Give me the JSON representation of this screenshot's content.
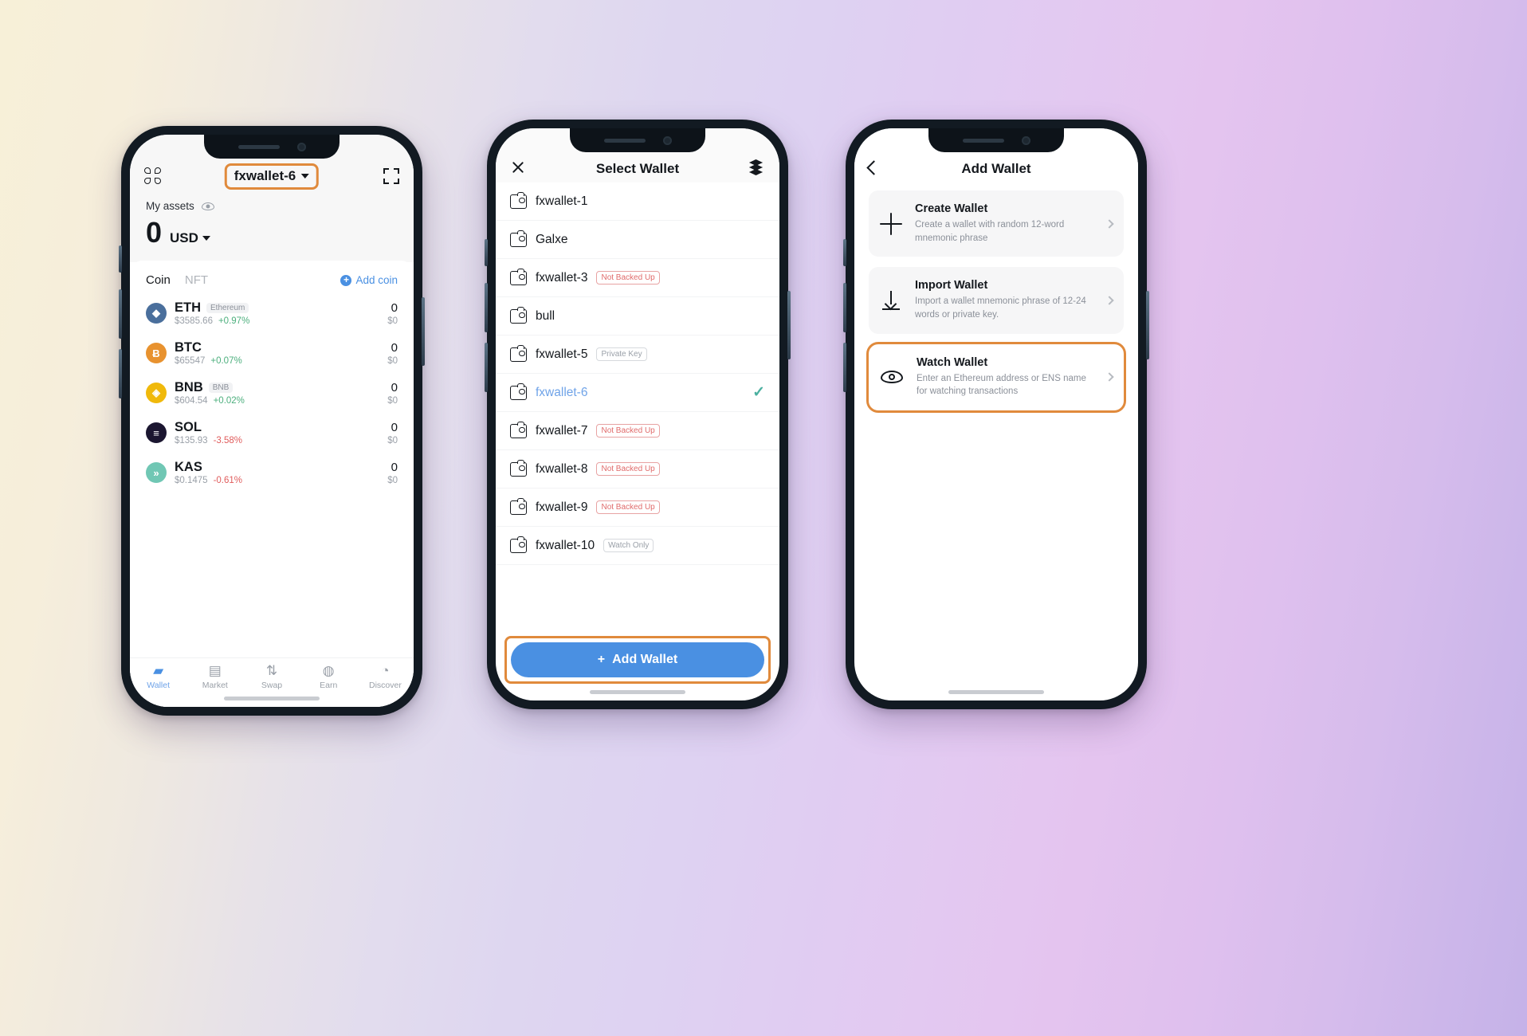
{
  "phone1": {
    "header": {
      "grid_icon": "grid-icon",
      "wallet_name": "fxwallet-6",
      "expand_icon": "expand-icon"
    },
    "assets": {
      "label": "My assets",
      "eye_icon": "eye-icon",
      "balance": "0",
      "currency": "USD"
    },
    "tabs": [
      {
        "label": "Coin",
        "active": true
      },
      {
        "label": "NFT",
        "active": false
      }
    ],
    "add_coin": "Add coin",
    "coins": [
      {
        "symbol": "ETH",
        "network": "Ethereum",
        "price": "$3585.66",
        "change": "+0.97%",
        "dir": "up",
        "amount": "0",
        "value": "$0",
        "color": "#4a6f9c",
        "glyph": "◆"
      },
      {
        "symbol": "BTC",
        "network": "",
        "price": "$65547",
        "change": "+0.07%",
        "dir": "up",
        "amount": "0",
        "value": "$0",
        "color": "#e8922f",
        "glyph": "Ƀ"
      },
      {
        "symbol": "BNB",
        "network": "BNB",
        "price": "$604.54",
        "change": "+0.02%",
        "dir": "up",
        "amount": "0",
        "value": "$0",
        "color": "#f0b90b",
        "glyph": "◈"
      },
      {
        "symbol": "SOL",
        "network": "",
        "price": "$135.93",
        "change": "-3.58%",
        "dir": "down",
        "amount": "0",
        "value": "$0",
        "color": "#1b1630",
        "glyph": "≡"
      },
      {
        "symbol": "KAS",
        "network": "",
        "price": "$0.1475",
        "change": "-0.61%",
        "dir": "down",
        "amount": "0",
        "value": "$0",
        "color": "#70c7b4",
        "glyph": "»"
      }
    ],
    "nav": [
      {
        "label": "Wallet",
        "icon": "wallet-icon",
        "glyph": "▰",
        "active": true
      },
      {
        "label": "Market",
        "icon": "chart-icon",
        "glyph": "▤",
        "active": false
      },
      {
        "label": "Swap",
        "icon": "swap-icon",
        "glyph": "⇅",
        "active": false
      },
      {
        "label": "Earn",
        "icon": "piggy-icon",
        "glyph": "◍",
        "active": false
      },
      {
        "label": "Discover",
        "icon": "compass-icon",
        "glyph": "◔",
        "active": false
      }
    ]
  },
  "phone2": {
    "header": {
      "close_icon": "close-icon",
      "title": "Select Wallet",
      "layers_icon": "layers-icon"
    },
    "wallets": [
      {
        "name": "fxwallet-1",
        "tag": "",
        "tag_style": "",
        "selected": false
      },
      {
        "name": "Galxe",
        "tag": "",
        "tag_style": "",
        "selected": false
      },
      {
        "name": "fxwallet-3",
        "tag": "Not Backed Up",
        "tag_style": "red",
        "selected": false
      },
      {
        "name": "bull",
        "tag": "",
        "tag_style": "",
        "selected": false
      },
      {
        "name": "fxwallet-5",
        "tag": "Private Key",
        "tag_style": "grey",
        "selected": false
      },
      {
        "name": "fxwallet-6",
        "tag": "",
        "tag_style": "",
        "selected": true
      },
      {
        "name": "fxwallet-7",
        "tag": "Not Backed Up",
        "tag_style": "red",
        "selected": false
      },
      {
        "name": "fxwallet-8",
        "tag": "Not Backed Up",
        "tag_style": "red",
        "selected": false
      },
      {
        "name": "fxwallet-9",
        "tag": "Not Backed Up",
        "tag_style": "red",
        "selected": false
      },
      {
        "name": "fxwallet-10",
        "tag": "Watch Only",
        "tag_style": "grey",
        "selected": false
      }
    ],
    "add_wallet_button": "Add Wallet",
    "check_glyph": "✓"
  },
  "phone3": {
    "header": {
      "back_icon": "back-chevron-icon",
      "title": "Add Wallet"
    },
    "options": [
      {
        "icon": "plus-icon",
        "title": "Create Wallet",
        "desc": "Create a wallet with random 12-word mnemonic phrase",
        "highlighted": false
      },
      {
        "icon": "import-download-icon",
        "title": "Import Wallet",
        "desc": "Import a wallet mnemonic phrase of 12-24 words or private key.",
        "highlighted": false
      },
      {
        "icon": "eye-icon",
        "title": "Watch Wallet",
        "desc": "Enter an Ethereum address or ENS name for watching transactions",
        "highlighted": true
      }
    ]
  },
  "colors": {
    "accent_blue": "#4a90e2",
    "highlight_orange": "#e08a3c",
    "up_green": "#4caf7d",
    "down_red": "#e05c5c",
    "selected_teal": "#4bb0a0"
  }
}
